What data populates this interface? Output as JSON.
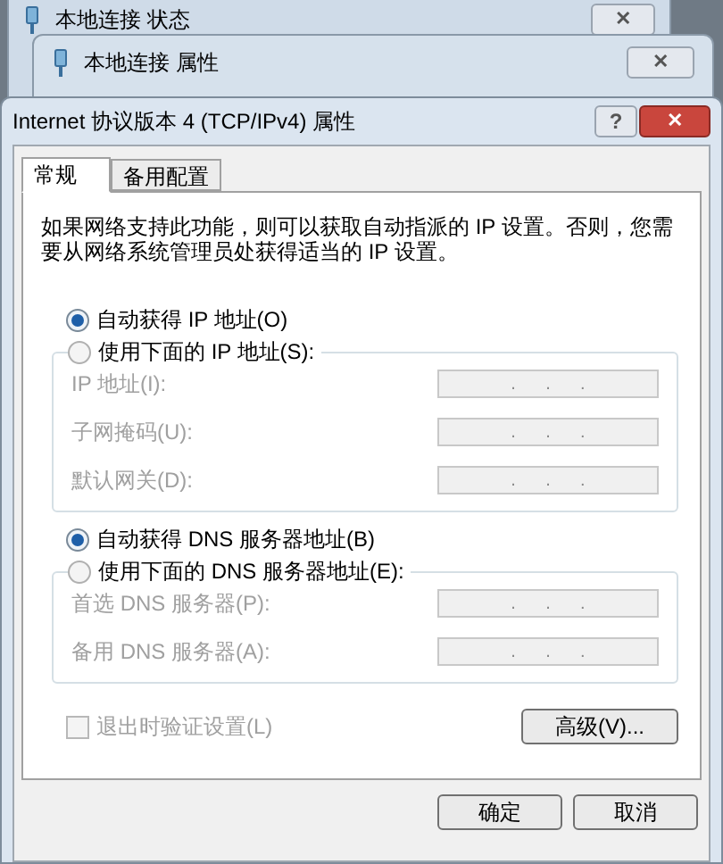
{
  "background_windows": [
    {
      "title": "本地连接 状态",
      "close": "✕"
    },
    {
      "title": "本地连接 属性",
      "close": "✕"
    }
  ],
  "dialog": {
    "title": "Internet 协议版本 4 (TCP/IPv4) 属性",
    "help": "?",
    "close": "✕",
    "tabs": [
      {
        "label": "常规",
        "selected": true
      },
      {
        "label": "备用配置",
        "selected": false
      }
    ],
    "description": "如果网络支持此功能，则可以获取自动指派的 IP 设置。否则，您需要从网络系统管理员处获得适当的 IP 设置。",
    "sections": [
      {
        "auto_option": {
          "label": "自动获得 IP 地址(O)",
          "selected": true
        },
        "manual_option": {
          "label": "使用下面的 IP 地址(S):",
          "selected": false
        },
        "disabled": true,
        "fields": [
          {
            "label": "IP 地址(I):",
            "value": ".      .      ."
          },
          {
            "label": "子网掩码(U):",
            "value": ".      .      ."
          },
          {
            "label": "默认网关(D):",
            "value": ".      .      ."
          }
        ]
      },
      {
        "auto_option": {
          "label": "自动获得 DNS 服务器地址(B)",
          "selected": true
        },
        "manual_option": {
          "label": "使用下面的 DNS 服务器地址(E):",
          "selected": false
        },
        "disabled": true,
        "fields": [
          {
            "label": "首选 DNS 服务器(P):",
            "value": ".      .      ."
          },
          {
            "label": "备用 DNS 服务器(A):",
            "value": ".      .      ."
          }
        ]
      }
    ],
    "validate_checkbox": {
      "label": "退出时验证设置(L)",
      "checked": false,
      "disabled": true
    },
    "advanced_button": "高级(V)...",
    "buttons": [
      "确定",
      "取消"
    ]
  }
}
